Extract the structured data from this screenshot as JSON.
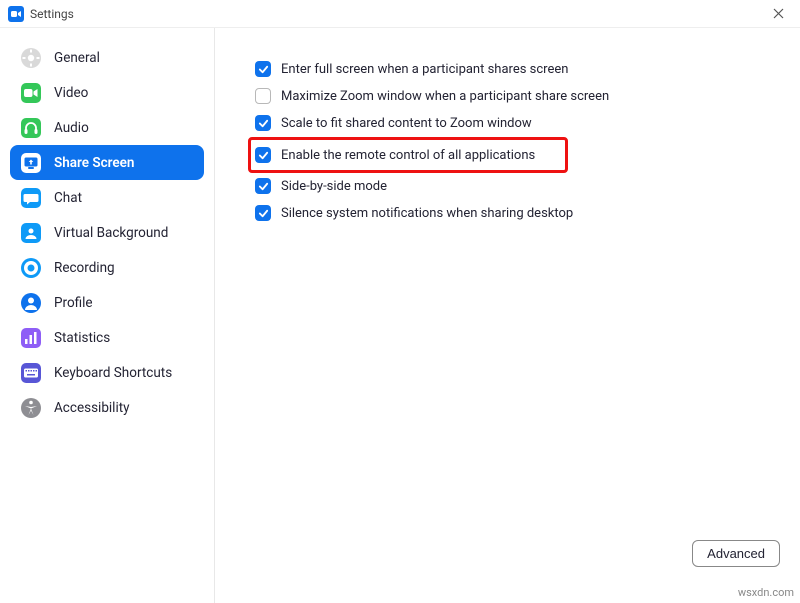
{
  "window": {
    "title": "Settings"
  },
  "sidebar": {
    "items": [
      {
        "label": "General"
      },
      {
        "label": "Video"
      },
      {
        "label": "Audio"
      },
      {
        "label": "Share Screen"
      },
      {
        "label": "Chat"
      },
      {
        "label": "Virtual Background"
      },
      {
        "label": "Recording"
      },
      {
        "label": "Profile"
      },
      {
        "label": "Statistics"
      },
      {
        "label": "Keyboard Shortcuts"
      },
      {
        "label": "Accessibility"
      }
    ],
    "active_index": 3
  },
  "options": {
    "enter_full_screen": {
      "label": "Enter full screen when a participant shares screen",
      "checked": true
    },
    "maximize_window": {
      "label": "Maximize Zoom window when a participant share screen",
      "checked": false
    },
    "scale_to_fit": {
      "label": "Scale to fit shared content to Zoom window",
      "checked": true
    },
    "enable_remote_control": {
      "label": "Enable the remote control of all applications",
      "checked": true,
      "highlighted": true
    },
    "side_by_side": {
      "label": "Side-by-side mode",
      "checked": true
    },
    "silence_notifications": {
      "label": "Silence system notifications when sharing desktop",
      "checked": true
    }
  },
  "buttons": {
    "advanced": "Advanced"
  },
  "watermark": "wsxdn.com",
  "colors": {
    "accent": "#0e72ec",
    "highlight": "#e11"
  },
  "icon_colors": {
    "general": "#d9d9d9",
    "video": "#34c759",
    "audio": "#34c759",
    "share_screen": "#34c759",
    "chat": "#0e9af7",
    "virtual_background": "#0e9af7",
    "recording": "#0e9af7",
    "profile": "#0e72ec",
    "statistics": "#8e5ef6",
    "keyboard": "#5856d6",
    "accessibility": "#8e8e93"
  }
}
